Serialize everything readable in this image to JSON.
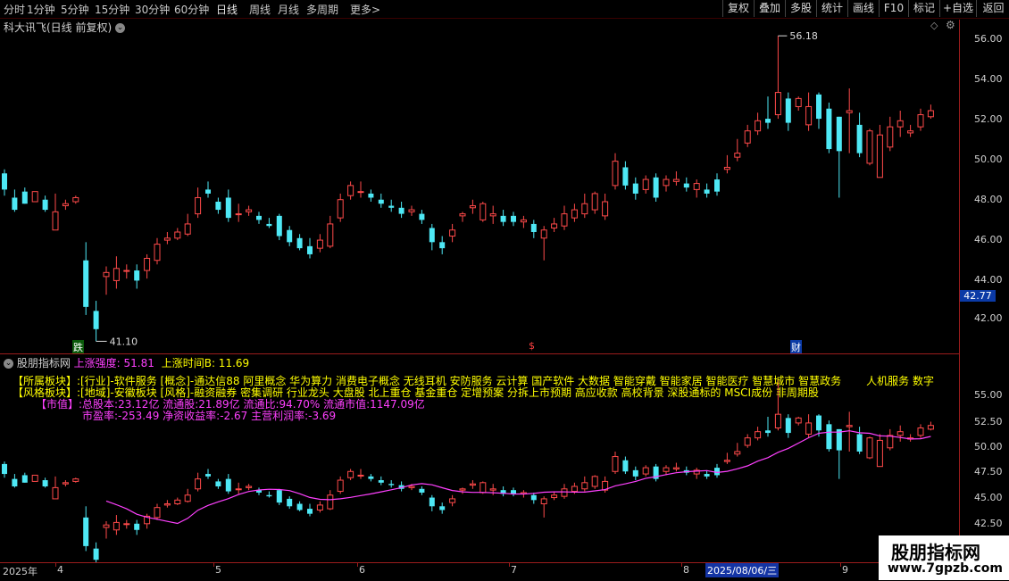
{
  "toolbar": {
    "periods": [
      "分时",
      "1分钟",
      "5分钟",
      "15分钟",
      "30分钟",
      "60分钟",
      "日线",
      "周线",
      "月线",
      "多周期",
      "更多"
    ],
    "more_arrow": ">",
    "right_buttons": [
      "复权",
      "叠加",
      "多股",
      "统计",
      "画线",
      "F10",
      "标记",
      "+自选",
      "返回"
    ]
  },
  "main_chart": {
    "title": "科大讯飞(日线 前复权)",
    "high_label": "56.18",
    "low_label": "41.10",
    "markers": [
      "跌",
      "$",
      "财"
    ],
    "current_price": "42.77"
  },
  "indicator": {
    "name": "股朋指标网",
    "line1_label": "上涨强度: 51.81",
    "line2_label": "上涨时间B: 11.69",
    "industry_key": "【所属板块】:",
    "industry_text": "[行业]-软件服务 [概念]-通达信88 阿里概念 华为算力 消费电子概念 无线耳机 安防服务 云计算 国产软件 大数据 智能穿戴 智能家居 智能医疗 智慧城市 智慧政务",
    "industry_tail": "人机服务 数字",
    "style_key": "【风格板块】:",
    "style_text": "[地域]-安徽板块 [风格]-融资融券 密集调研 行业龙头 大盘股 北上重仓 基金重仓 定增预案 分拆上市预期 高应收款 高校背景 深股通标的 MSCI成份 非周期股",
    "market_key": "【市值】:",
    "market_text": "总股本:23.12亿 流通股:21.89亿 流通比:94.70% 流通市值:1147.09亿",
    "pe_text": "市盈率:-253.49 净资收益率:-2.67 主营利润率:-3.69"
  },
  "price_axis": [
    "56.00",
    "54.00",
    "52.00",
    "50.00",
    "48.00",
    "46.00",
    "44.00",
    "42.00"
  ],
  "ind_axis": [
    "55.00",
    "52.50",
    "50.00",
    "47.50",
    "45.00",
    "42.50"
  ],
  "date_axis": {
    "year": "2025年",
    "months": [
      "4",
      "5",
      "6",
      "7",
      "8",
      "9"
    ],
    "cursor_date": "2025/08/06/三"
  },
  "watermark": {
    "title": "股朋指标网",
    "url": "www.7gpzb.com"
  },
  "colors": {
    "up": "#ff4a4a",
    "down": "#4ee8f5",
    "ma": "#ff40ff",
    "info_yellow": "#ffff00",
    "info_magenta": "#ff40ff"
  },
  "chart_data": {
    "type": "candlestick",
    "open": [
      49.4,
      48.2,
      48.5,
      48.0,
      48.1,
      46.6,
      47.8,
      48.0,
      45.1,
      42.6,
      44.3,
      44.1,
      44.6,
      44.6,
      44.6,
      45.1,
      46.1,
      46.2,
      46.4,
      47.4,
      48.6,
      48.0,
      48.2,
      47.4,
      47.5,
      47.3,
      46.9,
      47.3,
      46.6,
      46.2,
      45.8,
      45.7,
      45.8,
      47.2,
      48.3,
      48.5,
      48.4,
      48.1,
      47.8,
      47.7,
      47.5,
      47.4,
      46.7,
      46.0,
      46.3,
      47.3,
      47.7,
      47.1,
      47.3,
      47.3,
      47.3,
      47.0,
      46.9,
      46.2,
      46.7,
      46.8,
      47.2,
      47.4,
      47.6,
      47.3,
      48.8,
      49.7,
      48.9,
      48.6,
      49.2,
      48.8,
      49.0,
      48.9,
      48.6,
      48.6,
      49.1,
      49.6,
      50.2,
      50.9,
      51.5,
      52.1,
      52.3,
      53.1,
      52.7,
      51.8,
      53.3,
      52.6,
      52.2,
      52.4,
      51.8,
      49.9,
      49.2,
      50.7,
      51.7,
      51.4,
      51.7,
      52.2
    ],
    "close": [
      48.6,
      47.6,
      47.9,
      48.5,
      47.6,
      47.5,
      47.9,
      48.2,
      42.8,
      41.7,
      44.5,
      44.7,
      44.6,
      44.1,
      45.2,
      45.9,
      46.2,
      46.5,
      46.9,
      48.2,
      48.4,
      47.6,
      47.2,
      47.4,
      47.6,
      47.1,
      46.8,
      46.3,
      46.0,
      45.7,
      45.4,
      46.1,
      46.9,
      48.1,
      48.8,
      48.5,
      48.2,
      47.9,
      47.7,
      47.4,
      47.6,
      47.1,
      46.0,
      45.7,
      46.6,
      47.4,
      47.8,
      47.9,
      47.4,
      47.0,
      47.0,
      47.1,
      46.5,
      46.6,
      46.9,
      47.4,
      47.6,
      47.9,
      48.4,
      48.0,
      50.0,
      48.8,
      48.4,
      49.1,
      48.2,
      49.1,
      49.1,
      48.7,
      48.9,
      48.4,
      48.5,
      49.7,
      50.4,
      51.5,
      52.0,
      51.9,
      53.4,
      51.9,
      53.1,
      52.7,
      52.1,
      50.6,
      50.5,
      52.5,
      50.4,
      51.5,
      51.3,
      51.7,
      52.0,
      51.5,
      52.3,
      52.5
    ],
    "high": [
      49.6,
      48.6,
      48.7,
      48.5,
      48.3,
      48.4,
      48.1,
      48.3,
      46.0,
      43.1,
      44.8,
      45.3,
      44.9,
      44.9,
      45.4,
      46.2,
      46.5,
      46.7,
      47.4,
      48.7,
      49.0,
      48.2,
      48.6,
      47.9,
      47.8,
      47.5,
      47.2,
      47.4,
      46.8,
      46.4,
      46.2,
      46.4,
      47.3,
      48.4,
      49.0,
      49.0,
      48.6,
      48.4,
      48.1,
      48.0,
      47.8,
      47.6,
      46.9,
      46.3,
      46.9,
      47.5,
      48.1,
      48.0,
      47.8,
      47.6,
      47.5,
      47.3,
      47.1,
      46.8,
      47.2,
      47.8,
      47.9,
      48.4,
      48.5,
      48.4,
      50.4,
      50.0,
      49.2,
      49.3,
      49.4,
      49.3,
      49.5,
      49.2,
      49.1,
      48.9,
      49.4,
      50.3,
      51.1,
      51.8,
      52.4,
      53.2,
      56.2,
      53.4,
      53.2,
      53.4,
      53.4,
      52.9,
      52.2,
      53.6,
      52.4,
      51.6,
      51.8,
      52.2,
      52.5,
      51.8,
      52.6,
      52.8
    ],
    "low": [
      48.3,
      47.5,
      47.9,
      48.0,
      47.5,
      46.8,
      47.6,
      47.9,
      42.4,
      41.1,
      43.4,
      43.7,
      44.2,
      43.7,
      44.2,
      44.9,
      45.9,
      46.1,
      46.3,
      47.2,
      48.2,
      47.4,
      47.0,
      47.0,
      47.3,
      46.9,
      46.7,
      46.1,
      45.8,
      45.6,
      45.2,
      45.5,
      45.7,
      47.0,
      48.1,
      48.2,
      48.0,
      47.7,
      47.5,
      47.2,
      47.3,
      46.9,
      45.6,
      45.4,
      46.0,
      47.0,
      47.4,
      47.0,
      46.9,
      46.8,
      46.8,
      46.7,
      46.2,
      45.1,
      46.5,
      46.6,
      47.0,
      47.2,
      47.4,
      47.1,
      48.6,
      48.6,
      48.1,
      48.4,
      48.0,
      48.5,
      48.8,
      48.5,
      48.2,
      48.2,
      48.3,
      49.4,
      50.0,
      50.7,
      51.3,
      51.6,
      52.1,
      51.5,
      52.5,
      51.5,
      51.6,
      50.4,
      48.2,
      50.4,
      50.2,
      49.8,
      49.9,
      50.5,
      51.2,
      51.2,
      51.5,
      52.1
    ],
    "ylim": [
      40.5,
      57.0
    ],
    "ind_ylim": [
      41.5,
      57.0
    ],
    "ma_start_index": 10,
    "ma_period": 10
  }
}
